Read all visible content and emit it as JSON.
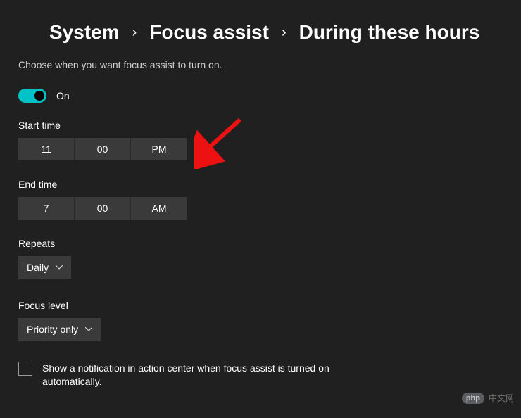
{
  "breadcrumb": {
    "parent1": "System",
    "parent2": "Focus assist",
    "current": "During these hours"
  },
  "description": "Choose when you want focus assist to turn on.",
  "toggle": {
    "state_label": "On"
  },
  "start_time": {
    "label": "Start time",
    "hour": "11",
    "minute": "00",
    "ampm": "PM"
  },
  "end_time": {
    "label": "End time",
    "hour": "7",
    "minute": "00",
    "ampm": "AM"
  },
  "repeats": {
    "label": "Repeats",
    "value": "Daily"
  },
  "focus_level": {
    "label": "Focus level",
    "value": "Priority only"
  },
  "notification_checkbox": {
    "label": "Show a notification in action center when focus assist is turned on automatically."
  },
  "watermark": {
    "badge": "php",
    "text": "中文网"
  }
}
